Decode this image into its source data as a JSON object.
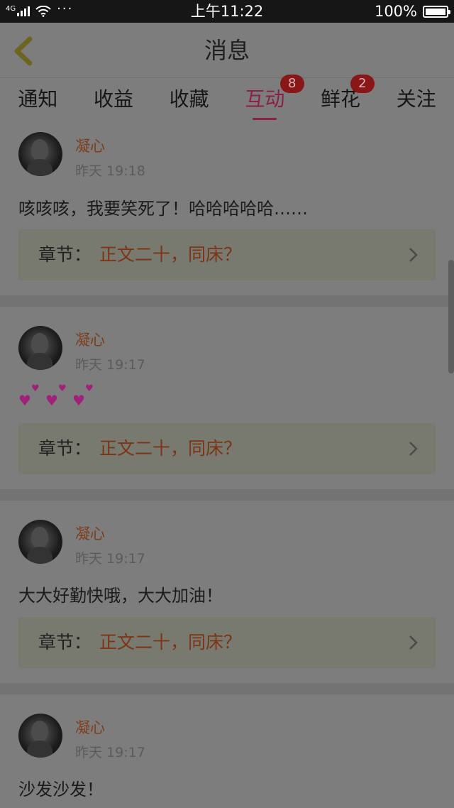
{
  "status_bar": {
    "network": "4G",
    "time": "上午11:22",
    "battery": "100%",
    "dots": "···"
  },
  "header": {
    "title": "消息",
    "back_icon": "chevron-left-icon"
  },
  "tabs": [
    {
      "label": "通知",
      "active": false,
      "badge": ""
    },
    {
      "label": "收益",
      "active": false,
      "badge": ""
    },
    {
      "label": "收藏",
      "active": false,
      "badge": ""
    },
    {
      "label": "互动",
      "active": true,
      "badge": "8"
    },
    {
      "label": "鲜花",
      "active": false,
      "badge": "2"
    },
    {
      "label": "关注",
      "active": false,
      "badge": ""
    }
  ],
  "messages": [
    {
      "user": "凝心",
      "time": "昨天 19:18",
      "text": "咳咳咳，我要笑死了！哈哈哈哈哈……",
      "chapter_label": "章节：",
      "chapter_name": "正文二十，同床？"
    },
    {
      "user": "凝心",
      "time": "昨天 19:17",
      "text": "💕💕💕",
      "chapter_label": "章节：",
      "chapter_name": "正文二十，同床？"
    },
    {
      "user": "凝心",
      "time": "昨天 19:17",
      "text": "大大好勤快哦，大大加油！",
      "chapter_label": "章节：",
      "chapter_name": "正文二十，同床？"
    },
    {
      "user": "凝心",
      "time": "昨天 19:17",
      "text": "沙发沙发！",
      "chapter_label": "",
      "chapter_name": ""
    }
  ],
  "colors": {
    "accent": "#8a1f47",
    "badge": "#8a1717",
    "username": "#7e3d1c",
    "chapter_name": "#7b3514"
  }
}
